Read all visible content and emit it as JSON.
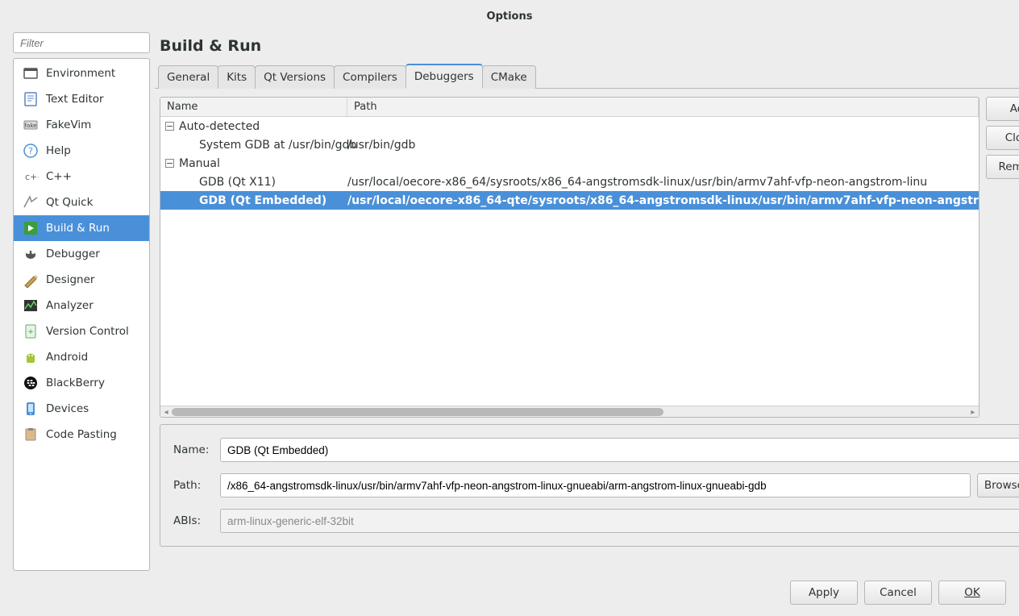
{
  "window_title": "Options",
  "filter_placeholder": "Filter",
  "sidebar": {
    "items": [
      {
        "label": "Environment",
        "icon": "environment"
      },
      {
        "label": "Text Editor",
        "icon": "text-editor"
      },
      {
        "label": "FakeVim",
        "icon": "fakevim"
      },
      {
        "label": "Help",
        "icon": "help"
      },
      {
        "label": "C++",
        "icon": "cpp"
      },
      {
        "label": "Qt Quick",
        "icon": "qtquick"
      },
      {
        "label": "Build & Run",
        "icon": "build-run"
      },
      {
        "label": "Debugger",
        "icon": "debugger"
      },
      {
        "label": "Designer",
        "icon": "designer"
      },
      {
        "label": "Analyzer",
        "icon": "analyzer"
      },
      {
        "label": "Version Control",
        "icon": "vcs"
      },
      {
        "label": "Android",
        "icon": "android"
      },
      {
        "label": "BlackBerry",
        "icon": "blackberry"
      },
      {
        "label": "Devices",
        "icon": "devices"
      },
      {
        "label": "Code Pasting",
        "icon": "paste"
      }
    ],
    "selected_index": 6
  },
  "page_title": "Build & Run",
  "tabs": [
    "General",
    "Kits",
    "Qt Versions",
    "Compilers",
    "Debuggers",
    "CMake"
  ],
  "active_tab": 4,
  "tree": {
    "columns": [
      "Name",
      "Path"
    ],
    "groups": [
      {
        "label": "Auto-detected",
        "items": [
          {
            "name": "System GDB at /usr/bin/gdb",
            "path": "/usr/bin/gdb"
          }
        ]
      },
      {
        "label": "Manual",
        "items": [
          {
            "name": "GDB (Qt X11)",
            "path": "/usr/local/oecore-x86_64/sysroots/x86_64-angstromsdk-linux/usr/bin/armv7ahf-vfp-neon-angstrom-linu"
          },
          {
            "name": "GDB (Qt Embedded)",
            "path": "/usr/local/oecore-x86_64-qte/sysroots/x86_64-angstromsdk-linux/usr/bin/armv7ahf-vfp-neon-angstr"
          }
        ]
      }
    ],
    "selected": [
      1,
      1
    ]
  },
  "buttons": {
    "add": "Add",
    "clone": "Clone",
    "remove": "Remove",
    "browse": "Browse...",
    "apply": "Apply",
    "cancel": "Cancel",
    "ok": "OK"
  },
  "form": {
    "name_label": "Name:",
    "path_label": "Path:",
    "abis_label": "ABIs:",
    "name_value": "GDB (Qt Embedded)",
    "path_value": "/x86_64-angstromsdk-linux/usr/bin/armv7ahf-vfp-neon-angstrom-linux-gnueabi/arm-angstrom-linux-gnueabi-gdb",
    "abis_value": "arm-linux-generic-elf-32bit"
  }
}
